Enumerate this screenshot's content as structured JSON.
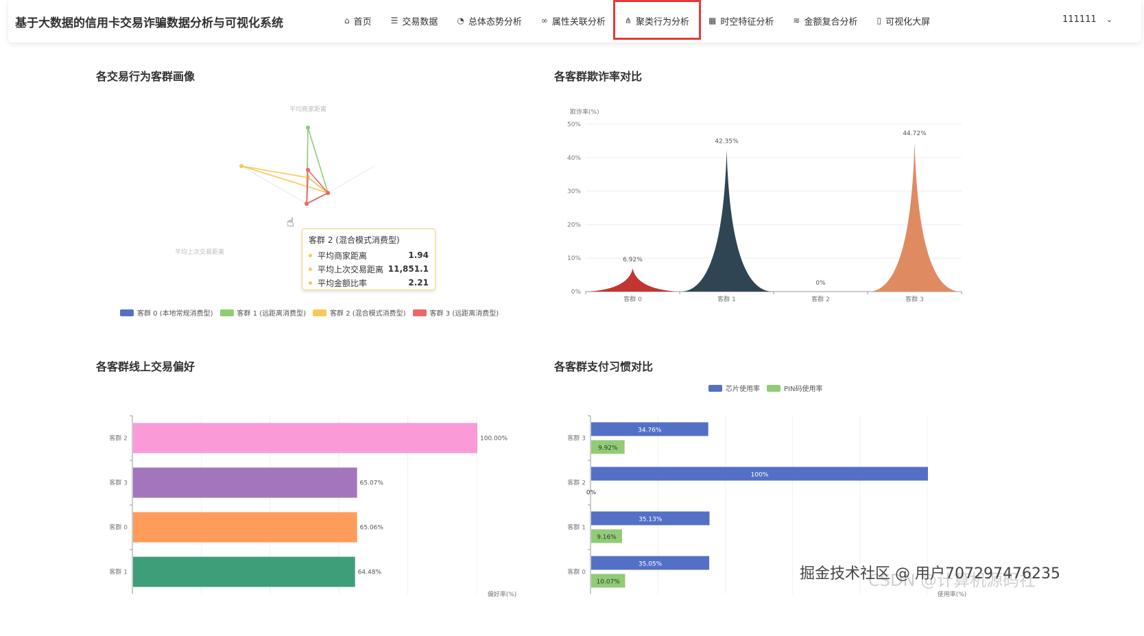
{
  "app": {
    "title": "基于大数据的信用卡交易诈骗数据分析与可视化系统",
    "user": "111111"
  },
  "nav": [
    {
      "label": "首页",
      "icon": "home-icon",
      "glyph": "⌂"
    },
    {
      "label": "交易数据",
      "icon": "database-icon",
      "glyph": "☰"
    },
    {
      "label": "总体态势分析",
      "icon": "pie-chart-icon",
      "glyph": "◔"
    },
    {
      "label": "属性关联分析",
      "icon": "link-icon",
      "glyph": "∞"
    },
    {
      "label": "聚类行为分析",
      "icon": "cluster-icon",
      "glyph": "⋔",
      "active": true
    },
    {
      "label": "时空特征分析",
      "icon": "map-icon",
      "glyph": "▦"
    },
    {
      "label": "金额复合分析",
      "icon": "coins-icon",
      "glyph": "≋"
    },
    {
      "label": "可视化大屏",
      "icon": "screen-icon",
      "glyph": "▯"
    }
  ],
  "panels": {
    "radar_title": "各交易行为客群画像",
    "fraud_title": "各客群欺诈率对比",
    "online_title": "各客群线上交易偏好",
    "payment_title": "各客群支付习惯对比"
  },
  "tooltip": {
    "title": "客群 2 (混合模式消费型)",
    "rows": [
      {
        "label": "平均商家距离",
        "value": "1.94"
      },
      {
        "label": "平均上次交易距离",
        "value": "11,851.1"
      },
      {
        "label": "平均金额比率",
        "value": "2.21"
      }
    ]
  },
  "watermark": {
    "text": "掘金技术社区 @ 用户707297476235",
    "faint": "CSDN @计算机源码社"
  },
  "colors": {
    "blue": "#5470c6",
    "green": "#91cc75",
    "yellow": "#fac858",
    "red": "#ee6666",
    "highlight": "#e53935"
  },
  "chart_data": [
    {
      "type": "radar",
      "title": "各交易行为客群画像",
      "indicators": [
        "平均商家距离",
        "平均上次交易距离",
        "平均金额比率"
      ],
      "series": [
        {
          "name": "客群 0 (本地常规消费型)",
          "color": "#5470c6",
          "values": [
            0.35,
            0.02,
            0.3
          ]
        },
        {
          "name": "客群 1 (远距离消费型)",
          "color": "#91cc75",
          "values": [
            1.0,
            0.02,
            0.3
          ]
        },
        {
          "name": "客群 2 (混合模式消费型)",
          "color": "#fac858",
          "values": [
            0.35,
            1.0,
            0.3
          ]
        },
        {
          "name": "客群 3 (远距离消费型)",
          "color": "#ee6666",
          "values": [
            0.45,
            0.02,
            0.3
          ]
        }
      ]
    },
    {
      "type": "area",
      "title": "各客群欺诈率对比",
      "ylabel": "欺诈率(%)",
      "ylim": [
        0,
        50
      ],
      "yticks": [
        "0%",
        "10%",
        "20%",
        "30%",
        "40%",
        "50%"
      ],
      "categories": [
        "客群 0",
        "客群 1",
        "客群 2",
        "客群 3"
      ],
      "values": [
        6.92,
        42.35,
        0,
        44.72
      ],
      "labels": [
        "6.92%",
        "42.35%",
        "0%",
        "44.72%"
      ],
      "colors": [
        "#c23531",
        "#2f4554",
        "#61a0a8",
        "#e08a62"
      ]
    },
    {
      "type": "bar",
      "title": "各客群线上交易偏好",
      "xlabel": "偏好率(%)",
      "categories": [
        "客群 2",
        "客群 3",
        "客群 0",
        "客群 1"
      ],
      "values": [
        100.0,
        65.07,
        65.06,
        64.48
      ],
      "labels": [
        "100.00%",
        "65.07%",
        "65.06%",
        "64.48%"
      ],
      "colors": [
        "#fa9bd8",
        "#a375bd",
        "#ff9c5b",
        "#3d9f7a"
      ]
    },
    {
      "type": "bar",
      "title": "各客群支付习惯对比",
      "xlabel": "使用率(%)",
      "categories": [
        "客群 3",
        "客群 2",
        "客群 1",
        "客群 0"
      ],
      "series": [
        {
          "name": "芯片使用率",
          "color": "#5470c6",
          "values": [
            34.76,
            100,
            35.13,
            35.05
          ],
          "labels": [
            "34.76%",
            "100%",
            "35.13%",
            "35.05%"
          ]
        },
        {
          "name": "PIN码使用率",
          "color": "#91cc75",
          "values": [
            9.92,
            0,
            9.16,
            10.07
          ],
          "labels": [
            "9.92%",
            "0%",
            "9.16%",
            "10.07%"
          ]
        }
      ]
    }
  ]
}
